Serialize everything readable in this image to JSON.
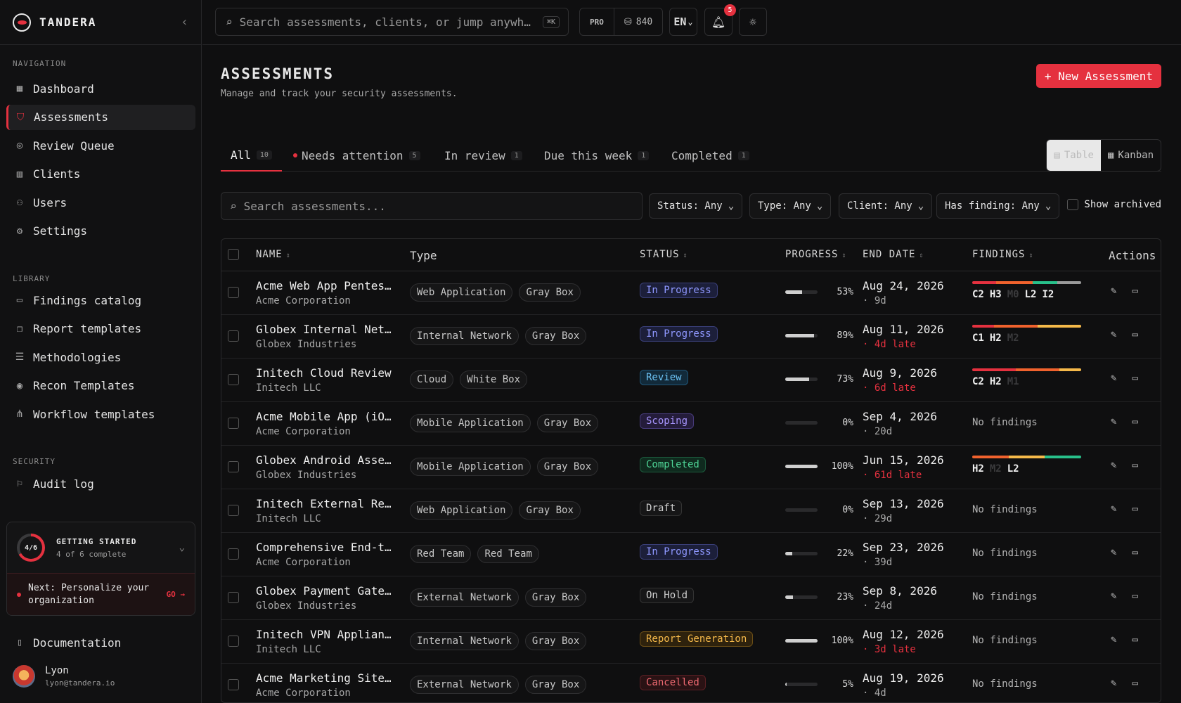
{
  "brand": {
    "name": "TANDERA"
  },
  "sidebar": {
    "navigation_label": "NAVIGATION",
    "navigation": [
      {
        "label": "Dashboard",
        "icon": "grid-icon"
      },
      {
        "label": "Assessments",
        "icon": "shield-icon",
        "active": true
      },
      {
        "label": "Review Queue",
        "icon": "check-circle-icon"
      },
      {
        "label": "Clients",
        "icon": "building-icon"
      },
      {
        "label": "Users",
        "icon": "users-icon"
      },
      {
        "label": "Settings",
        "icon": "gear-icon"
      }
    ],
    "library_label": "LIBRARY",
    "library": [
      {
        "label": "Findings catalog",
        "icon": "archive-icon"
      },
      {
        "label": "Report templates",
        "icon": "copy-icon"
      },
      {
        "label": "Methodologies",
        "icon": "list-icon"
      },
      {
        "label": "Recon Templates",
        "icon": "target-icon"
      },
      {
        "label": "Workflow templates",
        "icon": "share-icon"
      }
    ],
    "security_label": "SECURITY",
    "security": [
      {
        "label": "Audit log",
        "icon": "flag-icon"
      }
    ],
    "getting_started": {
      "ring": "4/6",
      "progress": 0.667,
      "title": "GETTING STARTED",
      "subtitle": "4 of 6 complete",
      "next": "Next: Personalize your organization",
      "go": "GO →"
    },
    "documentation": "Documentation",
    "user": {
      "name": "Lyon",
      "email": "lyon@tandera.io"
    }
  },
  "topbar": {
    "search_placeholder": "Search assessments, clients, or jump anywh…",
    "shortcut": "⌘K",
    "plan": "PRO",
    "credits": "840",
    "language": "EN",
    "notifications": "5"
  },
  "page": {
    "title": "ASSESSMENTS",
    "subtitle": "Manage and track your security assessments.",
    "new_button": "+ New Assessment"
  },
  "tabs": [
    {
      "label": "All",
      "count": "10"
    },
    {
      "label": "Needs attention",
      "count": "5"
    },
    {
      "label": "In review",
      "count": "1"
    },
    {
      "label": "Due this week",
      "count": "1"
    },
    {
      "label": "Completed",
      "count": "1"
    }
  ],
  "view": {
    "table": "Table",
    "kanban": "Kanban"
  },
  "filters": {
    "search_placeholder": "Search assessments...",
    "status": "Status: Any",
    "type": "Type: Any",
    "client": "Client: Any",
    "finding": "Has finding: Any",
    "archived": "Show archived"
  },
  "columns": {
    "name": "NAME",
    "type": "Type",
    "status": "STATUS",
    "progress": "PROGRESS",
    "end_date": "END DATE",
    "findings": "FINDINGS",
    "actions": "Actions"
  },
  "colors": {
    "accent": "#e5313f",
    "critical": "#e5313f",
    "high": "#f0622d",
    "medium": "#f5b94a",
    "low": "#28c08a",
    "info": "#9a9a9a"
  },
  "rows": [
    {
      "name": "Acme Web App Pentest…",
      "client": "Acme Corporation",
      "tags": [
        "Web Application",
        "Gray Box"
      ],
      "status": "In Progress",
      "status_kind": "progress",
      "progress": 53,
      "pct": "53%",
      "date": "Aug 24, 2026",
      "due": "· 9d",
      "late": false,
      "findings": [
        {
          "l": "C2",
          "s": "critical",
          "n": 2
        },
        {
          "l": "H3",
          "s": "high",
          "n": 3
        },
        {
          "l": "M0",
          "s": "medium",
          "n": 0
        },
        {
          "l": "L2",
          "s": "low",
          "n": 2
        },
        {
          "l": "I2",
          "s": "info",
          "n": 2
        }
      ]
    },
    {
      "name": "Globex Internal Netw…",
      "client": "Globex Industries",
      "tags": [
        "Internal Network",
        "Gray Box"
      ],
      "status": "In Progress",
      "status_kind": "progress",
      "progress": 89,
      "pct": "89%",
      "date": "Aug 11, 2026",
      "due": "· 4d late",
      "late": true,
      "findings": [
        {
          "l": "C1",
          "s": "critical",
          "n": 1
        },
        {
          "l": "H2",
          "s": "high",
          "n": 2
        },
        {
          "l": "M2",
          "s": "medium",
          "n": 2
        }
      ]
    },
    {
      "name": "Initech Cloud Review",
      "client": "Initech LLC",
      "tags": [
        "Cloud",
        "White Box"
      ],
      "status": "Review",
      "status_kind": "review",
      "progress": 73,
      "pct": "73%",
      "date": "Aug 9, 2026",
      "due": "· 6d late",
      "late": true,
      "findings": [
        {
          "l": "C2",
          "s": "critical",
          "n": 2
        },
        {
          "l": "H2",
          "s": "high",
          "n": 2
        },
        {
          "l": "M1",
          "s": "medium",
          "n": 1
        }
      ]
    },
    {
      "name": "Acme Mobile App (iOS)",
      "client": "Acme Corporation",
      "tags": [
        "Mobile Application",
        "Gray Box"
      ],
      "status": "Scoping",
      "status_kind": "scoping",
      "progress": 0,
      "pct": "0%",
      "date": "Sep 4, 2026",
      "due": "· 20d",
      "late": false,
      "findings": []
    },
    {
      "name": "Globex Android Asses…",
      "client": "Globex Industries",
      "tags": [
        "Mobile Application",
        "Gray Box"
      ],
      "status": "Completed",
      "status_kind": "completed",
      "progress": 100,
      "pct": "100%",
      "date": "Jun 15, 2026",
      "due": "· 61d late",
      "late": true,
      "findings": [
        {
          "l": "H2",
          "s": "high",
          "n": 2
        },
        {
          "l": "M2",
          "s": "medium",
          "n": 2
        },
        {
          "l": "L2",
          "s": "low",
          "n": 2
        }
      ]
    },
    {
      "name": "Initech External Rec…",
      "client": "Initech LLC",
      "tags": [
        "Web Application",
        "Gray Box"
      ],
      "status": "Draft",
      "status_kind": "draft",
      "progress": 0,
      "pct": "0%",
      "date": "Sep 13, 2026",
      "due": "· 29d",
      "late": false,
      "findings": []
    },
    {
      "name": "Comprehensive End-to…",
      "client": "Acme Corporation",
      "tags": [
        "Red Team",
        "Red Team"
      ],
      "status": "In Progress",
      "status_kind": "progress",
      "progress": 22,
      "pct": "22%",
      "date": "Sep 23, 2026",
      "due": "· 39d",
      "late": false,
      "findings": []
    },
    {
      "name": "Globex Payment Gatew…",
      "client": "Globex Industries",
      "tags": [
        "External Network",
        "Gray Box"
      ],
      "status": "On Hold",
      "status_kind": "draft",
      "progress": 23,
      "pct": "23%",
      "date": "Sep 8, 2026",
      "due": "· 24d",
      "late": false,
      "findings": []
    },
    {
      "name": "Initech VPN Applianc…",
      "client": "Initech LLC",
      "tags": [
        "Internal Network",
        "Gray Box"
      ],
      "status": "Report Generation",
      "status_kind": "report",
      "progress": 100,
      "pct": "100%",
      "date": "Aug 12, 2026",
      "due": "· 3d late",
      "late": true,
      "findings": []
    },
    {
      "name": "Acme Marketing Site …",
      "client": "Acme Corporation",
      "tags": [
        "External Network",
        "Gray Box"
      ],
      "status": "Cancelled",
      "status_kind": "cancelled",
      "progress": 5,
      "pct": "5%",
      "date": "Aug 19, 2026",
      "due": "· 4d",
      "late": false,
      "findings": []
    }
  ],
  "no_findings": "No findings"
}
